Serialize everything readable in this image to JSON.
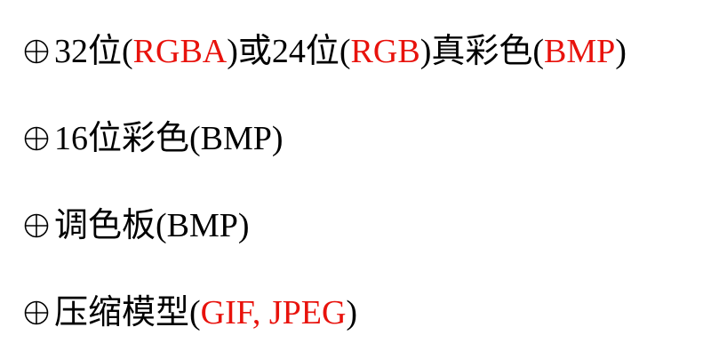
{
  "accent_color": "#e8120c",
  "bullet_icon": "circled-plus-icon",
  "lines": [
    {
      "segments": [
        {
          "text": "32位(",
          "highlight": false
        },
        {
          "text": "RGBA",
          "highlight": true
        },
        {
          "text": ")或24位(",
          "highlight": false
        },
        {
          "text": "RGB",
          "highlight": true
        },
        {
          "text": ")真彩色(",
          "highlight": false
        },
        {
          "text": "BMP",
          "highlight": true
        },
        {
          "text": ")",
          "highlight": false
        }
      ]
    },
    {
      "segments": [
        {
          "text": "16位彩色(BMP)",
          "highlight": false
        }
      ]
    },
    {
      "segments": [
        {
          "text": "调色板(BMP)",
          "highlight": false
        }
      ]
    },
    {
      "segments": [
        {
          "text": "压缩模型(",
          "highlight": false
        },
        {
          "text": "GIF, JPEG",
          "highlight": true
        },
        {
          "text": ")",
          "highlight": false
        }
      ]
    }
  ]
}
